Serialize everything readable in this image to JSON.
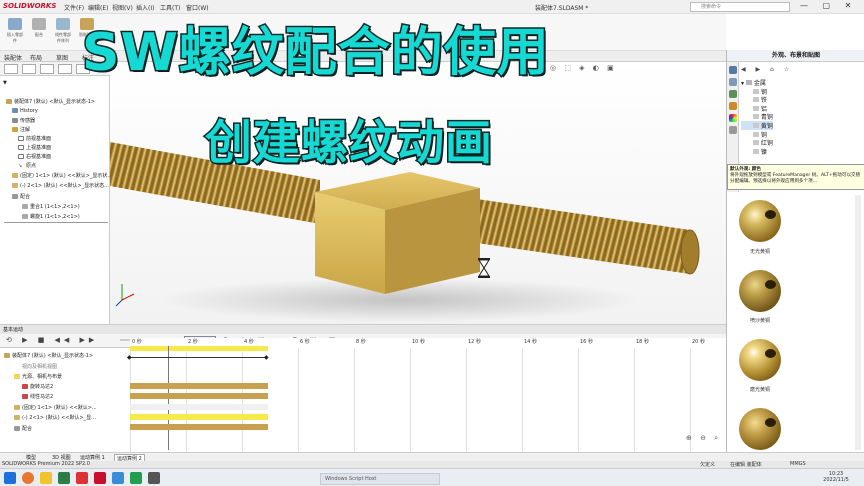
{
  "app": {
    "logo": "SOLIDWORKS",
    "doc_title": "装配体7.SLDASM *",
    "search_placeholder": "搜索命令",
    "window_controls": "— ▢ ✕"
  },
  "menu": [
    "文件(F)",
    "编辑(E)",
    "视图(V)",
    "插入(I)",
    "工具(T)",
    "窗口(W)"
  ],
  "ribbon_labels": [
    "插入零部件",
    "配合",
    "线性零部件阵列",
    "智能扣件"
  ],
  "command_tabs": [
    "装配体",
    "布局",
    "草图",
    "标注"
  ],
  "overlay": {
    "line1": "SW螺纹配合的使用",
    "line2": "创建螺纹动画"
  },
  "feature_tree": {
    "root": "装配体7 (默认) <默认_显示状态-1>",
    "items": [
      "History",
      "传感器",
      "注解",
      "前视基准面",
      "上视基准面",
      "右视基准面",
      "原点",
      "(固定) 1<1> (默认) <<默认>_显示状...",
      "(-) 2<1> (默认) <<默认>_显示状态...",
      "配合",
      "重合1 (1<1>,2<1>)",
      "螺旋1 (1<1>,2<1>)"
    ]
  },
  "motion": {
    "tab_label": "基本运动",
    "time_field": "5s",
    "ticks": [
      "0 秒",
      "2 秒",
      "4 秒",
      "6 秒",
      "8 秒",
      "10 秒",
      "12 秒",
      "14 秒",
      "16 秒",
      "18 秒",
      "20 秒"
    ],
    "tree": [
      "装配体7 (默认) <默认_显示状态-1>",
      "视向及相机视图",
      "光源、相机与布景",
      "旋转马达2",
      "线性马达2",
      "(固定) 1<1> (默认) <<默认>...",
      "(-) 2<1> (默认) <<默认>_显...",
      "配合"
    ]
  },
  "bottom_tabs": [
    "模型",
    "3D 视图",
    "运动算例 1",
    "运动算例 2"
  ],
  "status": {
    "left": "SOLIDWORKS Premium 2022 SP2.0",
    "mid": "欠定义",
    "editing": "在编辑 装配体",
    "mmgs": "MMGS"
  },
  "right_pane": {
    "title": "外观、布景和贴图",
    "tree": [
      "金属",
      "钢",
      "铁",
      "铝",
      "青铜",
      "黄铜",
      "铜",
      "红铜",
      "镍"
    ],
    "selected": "黄铜",
    "tip_title": "默认外观: 颜色",
    "tip_text": "将外观拖放到模型或 FeatureManager 树。ALT+拖动可以交替分配编辑。预选择以将外观应用到多个项...",
    "swatches": [
      "无光黄铜",
      "喷沙黄铜",
      "磨光黄铜",
      ""
    ]
  },
  "taskbar": {
    "center_text": "Windows Script Host",
    "time": "10:23",
    "date": "2022/11/5"
  },
  "colors": {
    "headline": "#17d9d3",
    "brass": "#c8a050",
    "sw_red": "#c8102e"
  }
}
